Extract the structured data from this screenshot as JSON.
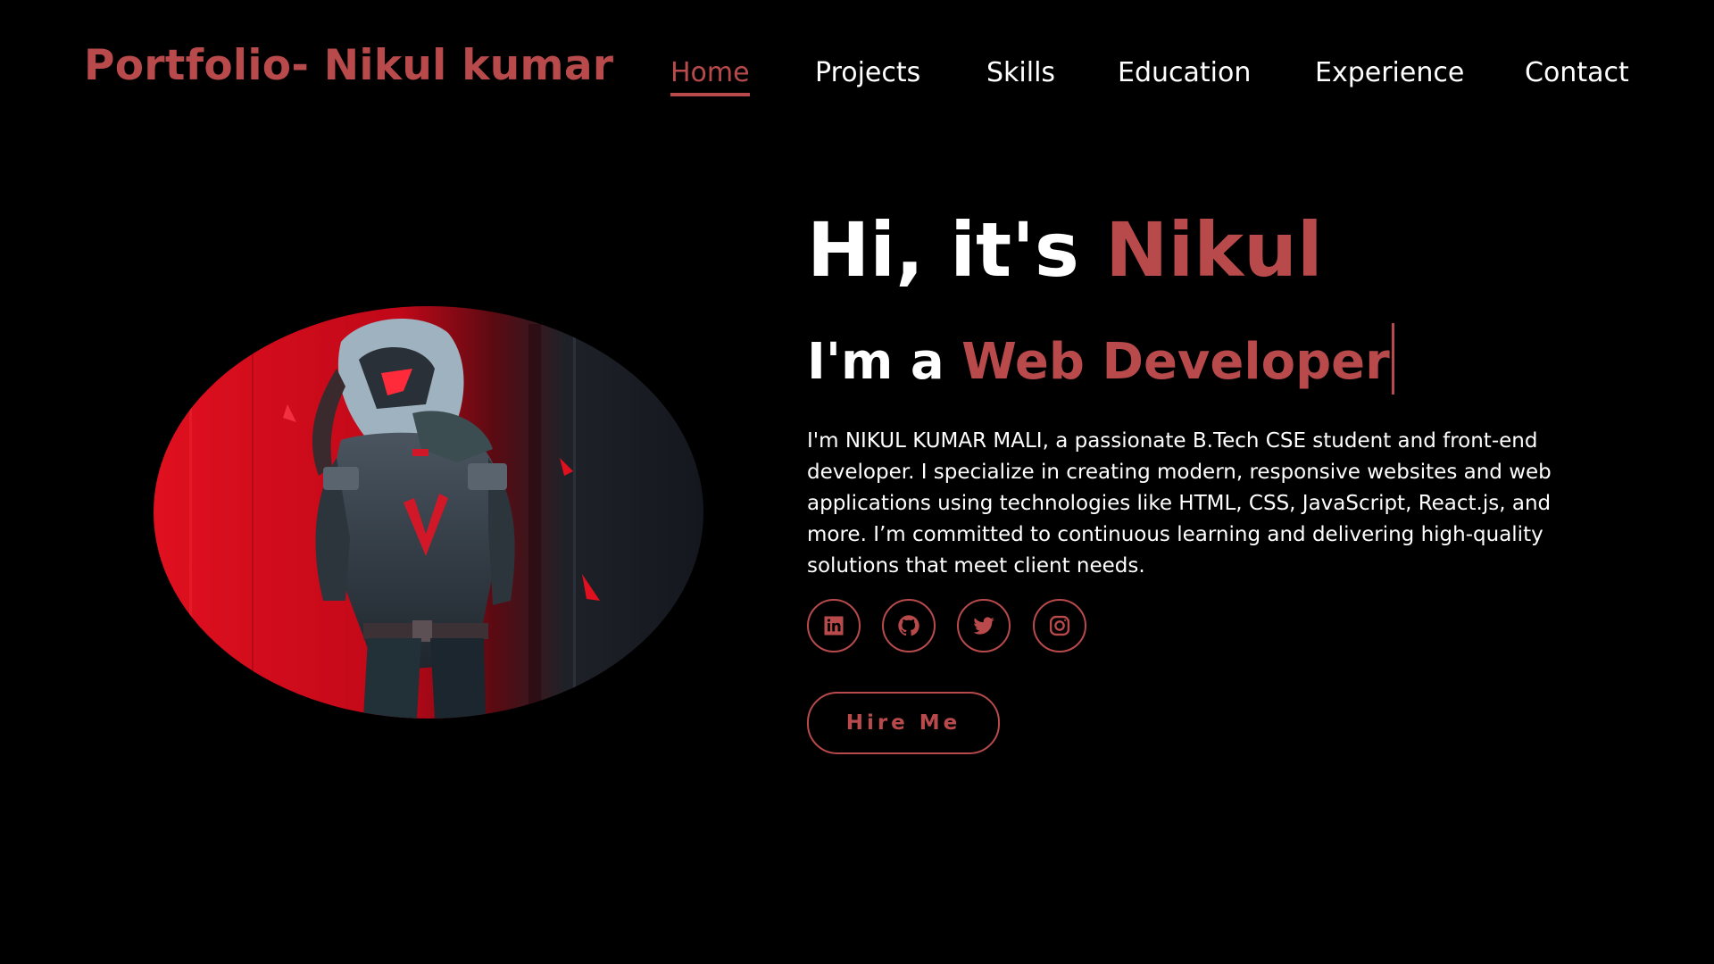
{
  "header": {
    "logo": "Portfolio- Nikul kumar",
    "nav": [
      {
        "label": "Home",
        "active": true
      },
      {
        "label": "Projects",
        "active": false
      },
      {
        "label": "Skills",
        "active": false
      },
      {
        "label": "Education",
        "active": false
      },
      {
        "label": "Experience",
        "active": false
      },
      {
        "label": "Contact",
        "active": false
      }
    ]
  },
  "hero": {
    "greeting_prefix": "Hi, it's",
    "greeting_name": "Nikul",
    "role_prefix": "I'm a",
    "role_typed": "Web Developer",
    "bio": "I'm NIKUL KUMAR MALI, a passionate B.Tech CSE student and front-end developer. I specialize in creating modern, responsive websites and web applications using technologies like HTML, CSS, JavaScript, React.js, and more. I’m committed to continuous learning and delivering high-quality solutions that meet client needs.",
    "hire_label": "Hire Me",
    "image_icon": "hooded-cyber-warrior-illustration"
  },
  "social": [
    {
      "icon": "linkedin-icon"
    },
    {
      "icon": "github-icon"
    },
    {
      "icon": "twitter-icon"
    },
    {
      "icon": "instagram-icon"
    }
  ],
  "colors": {
    "background": "#000000",
    "accent": "#b94a4b",
    "text": "#ffffff"
  }
}
